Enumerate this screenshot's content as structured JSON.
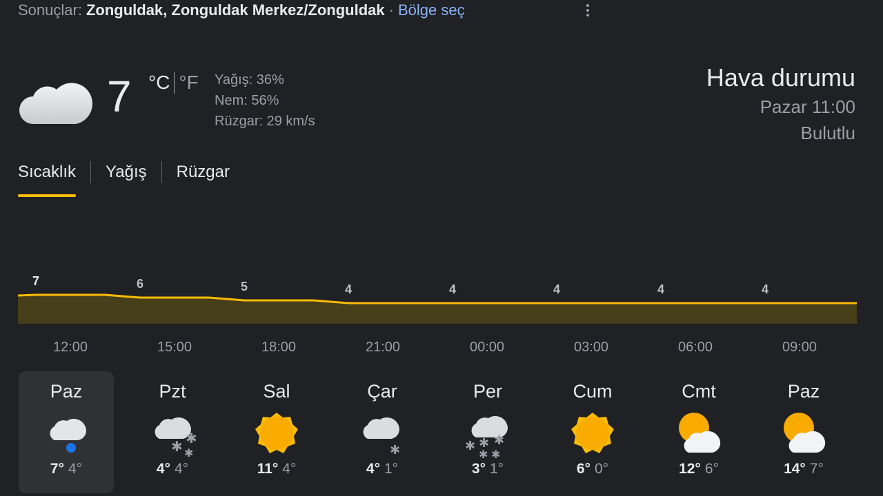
{
  "header": {
    "results_label": "Sonuçlar:",
    "location": "Zonguldak, Zonguldak Merkez/Zonguldak",
    "separator": "·",
    "region_link": "Bölge seç"
  },
  "current": {
    "icon": "cloud-icon",
    "temperature": "7",
    "unit_c": "°C",
    "unit_f": "°F",
    "precipitation": "Yağış: 36%",
    "humidity": "Nem: 56%",
    "wind": "Rüzgar: 29 km/s"
  },
  "summary": {
    "title": "Hava durumu",
    "datetime": "Pazar 11:00",
    "condition": "Bulutlu"
  },
  "tabs": [
    {
      "label": "Sıcaklık",
      "active": true
    },
    {
      "label": "Yağış",
      "active": false
    },
    {
      "label": "Rüzgar",
      "active": false
    }
  ],
  "colors": {
    "accent": "#fbbc04",
    "area_fill": "#473e1a",
    "link": "#8ab4f8",
    "background": "#202124"
  },
  "chart_data": {
    "type": "area",
    "x": [
      "12:00",
      "15:00",
      "18:00",
      "21:00",
      "00:00",
      "03:00",
      "06:00",
      "09:00"
    ],
    "values": [
      7,
      6,
      5,
      4,
      4,
      4,
      4,
      4
    ],
    "series": [
      {
        "values": [
          7,
          6,
          5,
          4,
          4,
          4,
          4,
          4
        ]
      }
    ],
    "grid": false,
    "legend": "none"
  },
  "days": [
    {
      "name": "Paz",
      "icon": "cloud-rain-icon",
      "high": "7°",
      "low": "4°",
      "selected": true
    },
    {
      "name": "Pzt",
      "icon": "cloud-snow-icon",
      "high": "4°",
      "low": "4°",
      "selected": false
    },
    {
      "name": "Sal",
      "icon": "sun-icon",
      "high": "11°",
      "low": "4°",
      "selected": false
    },
    {
      "name": "Çar",
      "icon": "cloud-snow-light-icon",
      "high": "4°",
      "low": "1°",
      "selected": false
    },
    {
      "name": "Per",
      "icon": "cloud-heavy-snow-icon",
      "high": "3°",
      "low": "1°",
      "selected": false
    },
    {
      "name": "Cum",
      "icon": "sun-icon",
      "high": "6°",
      "low": "0°",
      "selected": false
    },
    {
      "name": "Cmt",
      "icon": "partly-cloudy-icon",
      "high": "12°",
      "low": "6°",
      "selected": false
    },
    {
      "name": "Paz",
      "icon": "partly-cloudy-icon",
      "high": "14°",
      "low": "7°",
      "selected": false
    }
  ]
}
